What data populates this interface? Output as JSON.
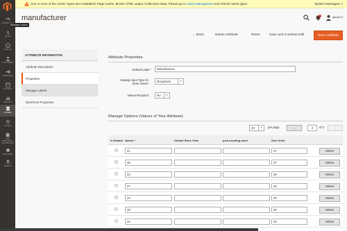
{
  "sidebar": {
    "tooltip": "Manage Labels",
    "items": [
      {
        "label": "DASHBOARD"
      },
      {
        "label": "SALES"
      },
      {
        "label": "CATALOG"
      },
      {
        "label": "CUSTOMERS"
      },
      {
        "label": "MARKETING"
      },
      {
        "label": "CONTENT"
      },
      {
        "label": "REPORTS"
      },
      {
        "label": "STORES"
      },
      {
        "label": "SYSTEM"
      },
      {
        "label": "FIND PARTNERS & EXTENSIONS"
      },
      {
        "label": "MAILCHIMP"
      },
      {
        "label": "AMAZON"
      }
    ]
  },
  "banner": {
    "before": "One or more of the Cache Types are invalidated: Page Cache, Blocks HTML output, Collections Data. Please go to ",
    "link": "Cache Management",
    "after": " and refresh cache types.",
    "system_messages": "System Messages: 1"
  },
  "header": {
    "title": "manufacturer",
    "notifications": "1",
    "user": "jabari3 ▾"
  },
  "actions": {
    "back": "← Back",
    "delete": "Delete Attribute",
    "reset": "Reset",
    "save_continue": "Save and Continue Edit",
    "save": "Save Attribute"
  },
  "tabs": {
    "title": "ATTRIBUTE INFORMATION",
    "items": [
      "Attribute Description",
      "Properties",
      "Manage Labels",
      "Storefront Properties"
    ]
  },
  "properties": {
    "title": "Attribute Properties",
    "default_label_label": "Default Label",
    "default_label_value": "Manufacturer",
    "input_type_label_1": "Catalog Input Type for",
    "input_type_label_2": "Store Owner",
    "input_type_value": "Dropdown",
    "values_required_label": "Values Required",
    "values_required_value": "No"
  },
  "options": {
    "title": "Manage Options (Values of Your Attribute)",
    "per_page_value": "20",
    "per_page_label": "per page",
    "page_value": "2",
    "page_of": "of 2",
    "columns": [
      "Is Default",
      "Admin *",
      "Default Store View",
      "just-a-testing-store",
      "Sort Order"
    ],
    "delete_label": "Delete",
    "rows": [
      {
        "admin": "21",
        "default_store": "",
        "testing_store": "",
        "sort": "27"
      },
      {
        "admin": "26",
        "default_store": "",
        "testing_store": "",
        "sort": "27"
      },
      {
        "admin": "22",
        "default_store": "",
        "testing_store": "",
        "sort": "28"
      },
      {
        "admin": "27",
        "default_store": "",
        "testing_store": "",
        "sort": "28"
      },
      {
        "admin": "23",
        "default_store": "",
        "testing_store": "",
        "sort": "29"
      },
      {
        "admin": "28",
        "default_store": "",
        "testing_store": "",
        "sort": "29"
      },
      {
        "admin": "24",
        "default_store": "",
        "testing_store": "",
        "sort": "30"
      }
    ]
  },
  "colors": {
    "accent": "#eb5202",
    "sidebar": "#373330",
    "banner": "#fffbbb"
  }
}
